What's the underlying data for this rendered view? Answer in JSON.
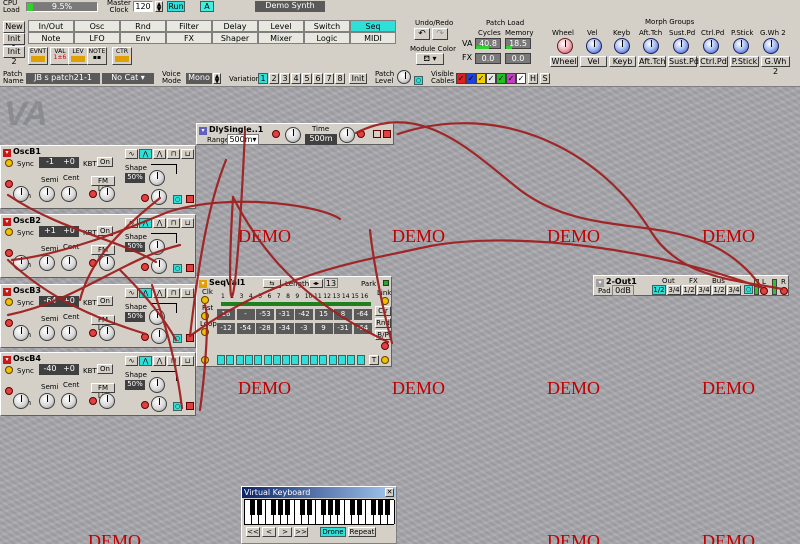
{
  "toolbar": {
    "cpu_label": "CPU\nLoad",
    "cpu_value": "9.5%",
    "master_clock_label": "Master\nClock",
    "master_clock_value": "120",
    "run_label": "Run",
    "a_label": "A",
    "synth_name": "Demo Synth",
    "new_label": "New",
    "init1_label": "Init 1",
    "init2_label": "Init 2",
    "tabs_row1": [
      "In/Out",
      "Osc",
      "Rnd",
      "Filter",
      "Delay",
      "Level",
      "Switch",
      "Seq"
    ],
    "tabs_row2": [
      "Note",
      "LFO",
      "Env",
      "FX",
      "Shaper",
      "Mixer",
      "Logic",
      "MIDI"
    ],
    "active_tab": "Seq",
    "palette": [
      "EVNT",
      "VAL",
      "LEV",
      "NOTE",
      "CTR"
    ],
    "undo_redo_label": "Undo/Redo",
    "module_color_label": "Module Color",
    "patch_load_label": "Patch Load",
    "cycles_label": "Cycles",
    "memory_label": "Memory",
    "va_label": "VA",
    "fx_label": "FX",
    "va_cycles": "40.8",
    "va_memory": "18.5",
    "fx_cycles": "0.0",
    "fx_memory": "0.0",
    "morph_groups_label": "Morph Groups",
    "morph_headers": [
      "Wheel",
      "Vel",
      "Keyb",
      "Aft.Tch",
      "Sust.Pd",
      "Ctrl.Pd",
      "P.Stick",
      "G.Wh 2"
    ],
    "morph_buttons": [
      "Wheel",
      "Vel",
      "Keyb",
      "Aft.Tch",
      "Sust.Pd",
      "Ctrl.Pd",
      "P.Stick",
      "G.Wh 2"
    ],
    "patch_name_label": "Patch\nName",
    "patch_name": "JB s patch21-1",
    "category": "No Cat",
    "voice_mode_label": "Voice\nMode",
    "voice_mode": "Mono",
    "variation_label": "Variation",
    "variations": [
      "1",
      "2",
      "3",
      "4",
      "5",
      "6",
      "7",
      "8"
    ],
    "init_label": "Init",
    "patch_level_label": "Patch\nLevel",
    "visible_cables_label": "Visible\nCables",
    "cable_h": "H",
    "cable_s": "S",
    "cable_colors": [
      "#e02020",
      "#2040e0",
      "#f0d000",
      "#e8e8e8",
      "#20c020",
      "#c040c0",
      "#ffffff"
    ]
  },
  "workspace": {
    "logo": "VA",
    "demo_text": "DEMO"
  },
  "modules": {
    "dly": {
      "title": "DlySingle..1",
      "range_label": "Range",
      "range_value": "500m",
      "time_label": "Time",
      "time_value": "500m"
    },
    "osc": [
      {
        "title": "OscB1",
        "sync": "Sync",
        "pitch_value": "-1",
        "fine_value": "+0",
        "kbt": "KBT",
        "kbt_value": "On",
        "semi": "Semi",
        "cent": "Cent",
        "fm": "FM Lin",
        "pitch": "Pitch",
        "shape": "Shape",
        "shape_value": "50%"
      },
      {
        "title": "OscB2",
        "sync": "Sync",
        "pitch_value": "+1",
        "fine_value": "+0",
        "kbt": "KBT",
        "kbt_value": "On",
        "semi": "Semi",
        "cent": "Cent",
        "fm": "FM Lin",
        "pitch": "Pitch",
        "shape": "Shape",
        "shape_value": "50%"
      },
      {
        "title": "OscB3",
        "sync": "Sync",
        "pitch_value": "-64",
        "fine_value": "+0",
        "kbt": "KBT",
        "kbt_value": "On",
        "semi": "Semi",
        "cent": "Cent",
        "fm": "FM Lin",
        "pitch": "Pitch",
        "shape": "Shape",
        "shape_value": "50%"
      },
      {
        "title": "OscB4",
        "sync": "Sync",
        "pitch_value": "-40",
        "fine_value": "+0",
        "kbt": "KBT",
        "kbt_value": "On",
        "semi": "Semi",
        "cent": "Cent",
        "fm": "FM Lin",
        "pitch": "Pitch",
        "shape": "Shape",
        "shape_value": "50%"
      }
    ],
    "seq": {
      "title": "SeqVal1",
      "length_label": "Length",
      "length_value": "13",
      "park_label": "Park",
      "link_label": "Link",
      "clk_label": "Clk",
      "rst_label": "Rst",
      "loop_label": "Loop",
      "steps": [
        "1",
        "2",
        "3",
        "4",
        "5",
        "6",
        "7",
        "8",
        "9",
        "10",
        "11",
        "12",
        "13",
        "14",
        "15",
        "16"
      ],
      "row1": [
        "16",
        "-",
        "-53",
        "-31",
        "-42",
        "15",
        "8",
        "-64"
      ],
      "row2": [
        "-12",
        "-54",
        "-28",
        "-34",
        "-3",
        "9",
        "-31",
        "-64"
      ],
      "clr": "Clr",
      "rnd": "Rnd",
      "bp": "B/P",
      "t_label": "T"
    },
    "out": {
      "title": "2-Out1",
      "pad_label": "Pad",
      "pad_value": "0dB",
      "out_label": "Out",
      "fx_label": "FX",
      "bus_label": "Bus",
      "options": [
        "1/2",
        "3/4",
        "1/2",
        "3/4",
        "1/2",
        "3/4"
      ],
      "l_label": "L",
      "r_label": "R"
    }
  },
  "keyboard": {
    "title": "Virtual Keyboard",
    "close": "✕",
    "nav": [
      "<<",
      "<",
      ">",
      ">>"
    ],
    "drone": "Drone",
    "repeat": "Repeat"
  }
}
